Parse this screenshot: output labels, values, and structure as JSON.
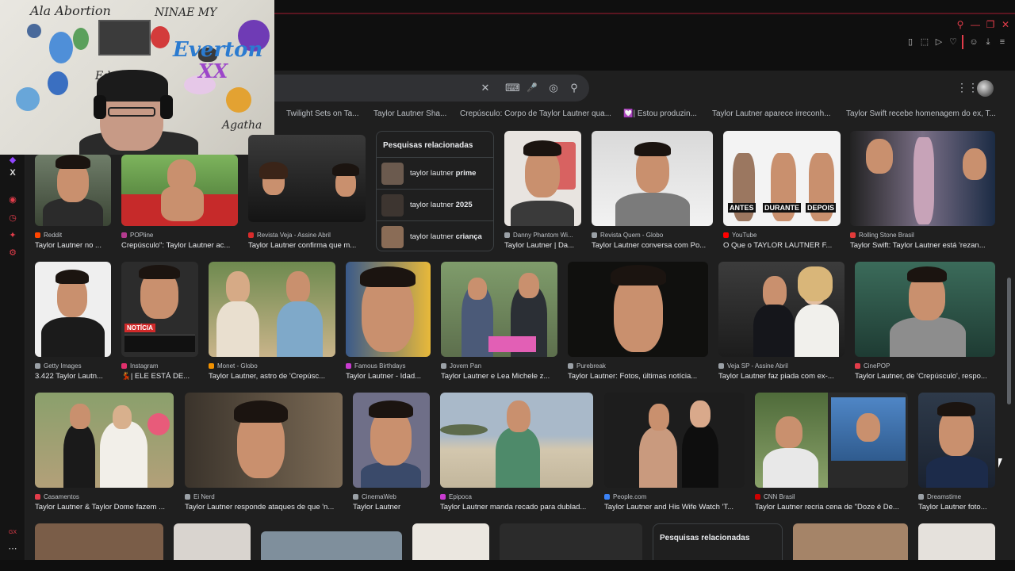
{
  "chips": [
    "Twilight Sets on Ta...",
    "Taylor Lautner Sha...",
    "Crepúsculo: Corpo de Taylor Lautner qua...",
    "💟| Estou produzin...",
    "Taylor Lautner aparece irreconh...",
    "Taylor Swift recebe homenagem do ex, T..."
  ],
  "search": {
    "clear_icon": "✕",
    "keyboard_icon": "⌨",
    "mic_icon": "🎤",
    "lens_icon": "◎",
    "search_icon": "⚲"
  },
  "related_1": {
    "title": "Pesquisas relacionadas",
    "items": [
      {
        "base": "taylor lautner ",
        "bold": "prime"
      },
      {
        "base": "taylor lautner ",
        "bold": "2025"
      },
      {
        "base": "taylor lautner ",
        "bold": "criança"
      }
    ]
  },
  "related_2": {
    "title": "Pesquisas relacionadas"
  },
  "row1": [
    {
      "source": "Reddit",
      "title": "Taylor Lautner no ...",
      "fav": "#ff4500"
    },
    {
      "source": "POPline",
      "title": "Crepúsculo\": Taylor Lautner ac...",
      "fav": "#b43b8f"
    },
    {
      "source": "Revista Veja - Assine Abril",
      "title": "Taylor Lautner confirma que m...",
      "fav": "#d92b2b"
    },
    {
      "source": "Danny Phantom Wi...",
      "title": "Taylor Lautner | Da...",
      "fav": "#9aa0a6"
    },
    {
      "source": "Revista Quem - Globo",
      "title": "Taylor Lautner conversa com Po...",
      "fav": "#9aa0a6"
    },
    {
      "source": "YouTube",
      "title": "O Que o TAYLOR LAUTNER F...",
      "fav": "#ff0000"
    },
    {
      "source": "Rolling Stone Brasil",
      "title": "Taylor Swift: Taylor Lautner está 'rezan...",
      "fav": "#e13a3a"
    }
  ],
  "row1_overlay": {
    "antes": "ANTES",
    "durante": "DURANTE",
    "depois": "DEPOIS"
  },
  "row2": [
    {
      "source": "Getty Images",
      "title": "3.422 Taylor Lautn...",
      "fav": "#9aa0a6"
    },
    {
      "source": "Instagram",
      "title": "💃| ELE ESTÁ DE...",
      "fav": "#e1306c"
    },
    {
      "source": "Monet - Globo",
      "title": "Taylor Lautner, astro de 'Crepúsc...",
      "fav": "#f29100"
    },
    {
      "source": "Famous Birthdays",
      "title": "Taylor Lautner - Idad...",
      "fav": "#c93bd0"
    },
    {
      "source": "Jovem Pan",
      "title": "Taylor Lautner e Lea Michele z...",
      "fav": "#9aa0a6"
    },
    {
      "source": "Purebreak",
      "title": "Taylor Lautner: Fotos, últimas notícia...",
      "fav": "#9aa0a6"
    },
    {
      "source": "Veja SP - Assine Abril",
      "title": "Taylor Lautner faz piada com ex-...",
      "fav": "#9aa0a6"
    },
    {
      "source": "CinePOP",
      "title": "Taylor Lautner, de 'Crepúsculo', respo...",
      "fav": "#e23c4a"
    }
  ],
  "row3": [
    {
      "source": "Casamentos",
      "title": "Taylor Lautner & Taylor Dome fazem ...",
      "fav": "#e23c4a"
    },
    {
      "source": "Ei Nerd",
      "title": "Taylor Lautner responde ataques de que 'n...",
      "fav": "#9aa0a6"
    },
    {
      "source": "CinemaWeb",
      "title": "Taylor Lautner",
      "fav": "#9aa0a6"
    },
    {
      "source": "Epipoca",
      "title": "Taylor Lautner manda recado para dublad...",
      "fav": "#c93bd0"
    },
    {
      "source": "People.com",
      "title": "Taylor Lautner and His Wife Watch 'T...",
      "fav": "#3b82f6"
    },
    {
      "source": "CNN Brasil",
      "title": "Taylor Lautner recria cena de \"Doze é De...",
      "fav": "#cc0000"
    },
    {
      "source": "Dreamstime",
      "title": "Taylor Lautner foto...",
      "fav": "#9aa0a6"
    }
  ],
  "noticia_label": "NOTÍCIA",
  "webcam_text": {
    "a": "Ala Abortion",
    "b": "NINAE MY",
    "c": "Everton",
    "d": "XX",
    "e": "Agatha",
    "f": "Edu"
  }
}
